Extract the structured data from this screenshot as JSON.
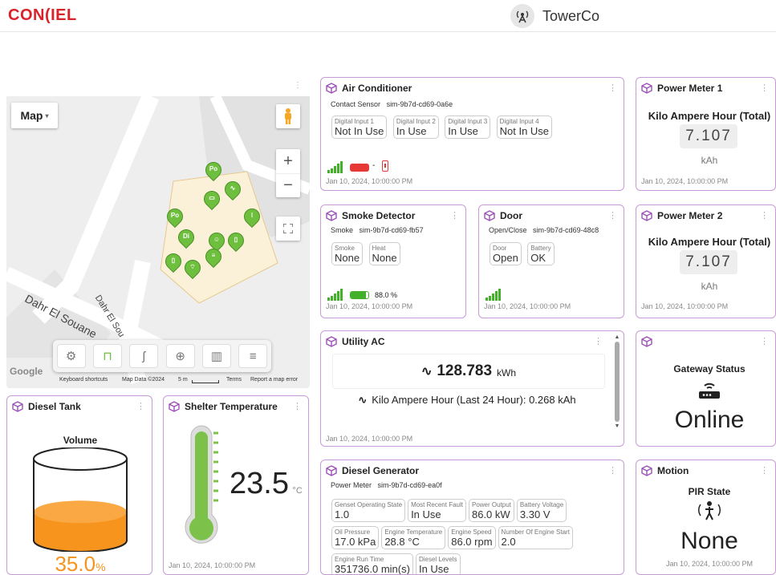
{
  "header": {
    "logo": "CON(IEL",
    "site_name": "TowerCo"
  },
  "map": {
    "map_type_label": "Map",
    "streets": [
      "Dahr El Souane",
      "Dahr El Sou"
    ],
    "zoom_in": "+",
    "zoom_out": "−",
    "pins": [
      "Po",
      "",
      "",
      "Po",
      "",
      "Di",
      "",
      "",
      "",
      "",
      ""
    ],
    "attribution": {
      "google": "Google",
      "shortcuts": "Keyboard shortcuts",
      "map_data": "Map Data ©2024",
      "scale": "5 m",
      "terms": "Terms",
      "report": "Report a map error"
    },
    "tools": [
      "gear-icon",
      "unlock-icon",
      "route-icon",
      "add-location-icon",
      "map-icon",
      "list-icon"
    ]
  },
  "air_conditioner": {
    "title": "Air Conditioner",
    "sensor": "Contact Sensor",
    "device_id": "sim-9b7d-cd69-0a6e",
    "inputs": [
      {
        "label": "Digital Input 1",
        "value": "Not In Use"
      },
      {
        "label": "Digital Input 2",
        "value": "In Use"
      },
      {
        "label": "Digital Input 3",
        "value": "In Use"
      },
      {
        "label": "Digital Input 4",
        "value": "Not In Use"
      }
    ],
    "battery_text": "-",
    "battery_color": "#e53935",
    "timestamp": "Jan 10, 2024, 10:00:00 PM"
  },
  "power_meter_1": {
    "title": "Power Meter 1",
    "metric": "Kilo Ampere Hour (Total)",
    "value": "7.107",
    "unit": "kAh",
    "timestamp": "Jan 10, 2024, 10:00:00 PM"
  },
  "smoke_detector": {
    "title": "Smoke Detector",
    "sensor": "Smoke",
    "device_id": "sim-9b7d-cd69-fb57",
    "inputs": [
      {
        "label": "Smoke",
        "value": "None"
      },
      {
        "label": "Heat",
        "value": "None"
      }
    ],
    "battery_text": "88.0 %",
    "battery_level": 0.88,
    "battery_color": "#43b02a",
    "timestamp": "Jan 10, 2024, 10:00:00 PM"
  },
  "door": {
    "title": "Door",
    "sensor": "Open/Close",
    "device_id": "sim-9b7d-cd69-48c8",
    "inputs": [
      {
        "label": "Door",
        "value": "Open"
      },
      {
        "label": "Battery",
        "value": "OK"
      }
    ],
    "timestamp": "Jan 10, 2024, 10:00:00 PM"
  },
  "power_meter_2": {
    "title": "Power Meter 2",
    "metric": "Kilo Ampere Hour (Total)",
    "value": "7.107",
    "unit": "kAh",
    "timestamp": "Jan 10, 2024, 10:00:00 PM"
  },
  "utility_ac": {
    "title": "Utility AC",
    "value": "128.783",
    "unit": "kWh",
    "metric": "Kilo Ampere Hour (Last 24 Hour): 0.268 kAh",
    "timestamp": "Jan 10, 2024, 10:00:00 PM"
  },
  "gateway": {
    "title": "",
    "label": "Gateway Status",
    "status": "Online"
  },
  "diesel_tank": {
    "title": "Diesel Tank",
    "label": "Volume",
    "value": "35.0",
    "unit": "%",
    "level": 0.35,
    "fill_color": "#f7941d"
  },
  "shelter_temperature": {
    "title": "Shelter Temperature",
    "value": "23.5",
    "unit": "°C",
    "timestamp": "Jan 10, 2024, 10:00:00 PM",
    "fill_color": "#7cc24a"
  },
  "diesel_generator": {
    "title": "Diesel Generator",
    "sensor": "Power Meter",
    "device_id": "sim-9b7d-cd69-ea0f",
    "row1": [
      {
        "label": "Genset Operating State",
        "value": "1.0"
      },
      {
        "label": "Most Recent Fault",
        "value": "In Use"
      },
      {
        "label": "Power Output",
        "value": "86.0 kW"
      },
      {
        "label": "Battery Voltage",
        "value": "3.30 V"
      }
    ],
    "row2": [
      {
        "label": "Oil Pressure",
        "value": "17.0 kPa"
      },
      {
        "label": "Engine Temperature",
        "value": "28.8 °C"
      },
      {
        "label": "Engine Speed",
        "value": "86.0 rpm"
      },
      {
        "label": "Number Of Engine Start",
        "value": "2.0"
      }
    ],
    "row3": [
      {
        "label": "Engine Run Time",
        "value": "351736.0 min(s)"
      },
      {
        "label": "Diesel Levels",
        "value": "In Use"
      }
    ]
  },
  "motion": {
    "title": "Motion",
    "label": "PIR State",
    "status": "None",
    "timestamp": "Jan 10, 2024, 10:00:00 PM"
  }
}
